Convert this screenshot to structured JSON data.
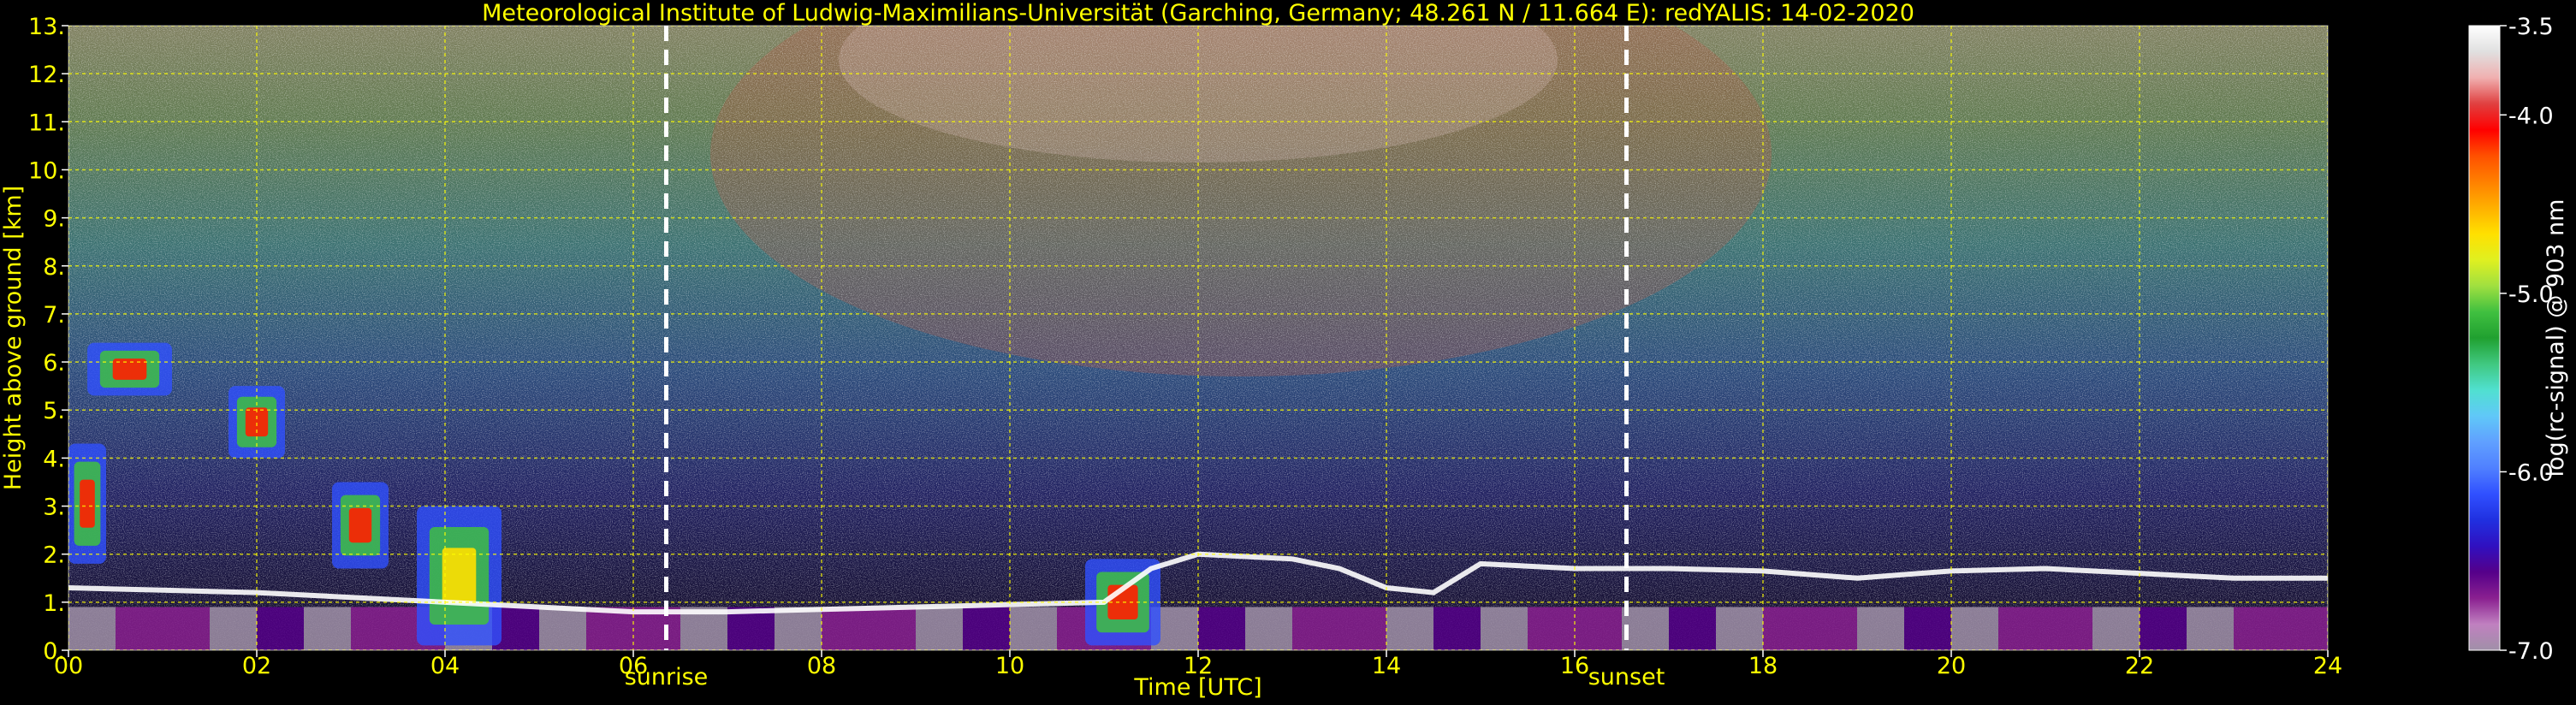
{
  "chart_data": {
    "type": "heatmap",
    "title": "Meteorological Institute of Ludwig-Maximilians-Universität (Garching, Germany; 48.261 N / 11.664 E):    redYALIS: 14-02-2020",
    "xlabel": "Time [UTC]",
    "ylabel": "Height above ground [km]",
    "xlim": [
      0,
      24
    ],
    "ylim": [
      0,
      13
    ],
    "x_ticks": [
      0,
      2,
      4,
      6,
      8,
      10,
      12,
      14,
      16,
      18,
      20,
      22,
      24
    ],
    "x_tick_labels": [
      "00",
      "02",
      "04",
      "06",
      "08",
      "10",
      "12",
      "14",
      "16",
      "18",
      "20",
      "22",
      "24"
    ],
    "y_ticks": [
      0,
      1,
      2,
      3,
      4,
      5,
      6,
      7,
      8,
      9,
      10,
      11,
      12,
      13
    ],
    "y_tick_labels": [
      "0.",
      "1.",
      "2.",
      "3.",
      "4.",
      "5.",
      "6.",
      "7.",
      "8.",
      "9.",
      "10.",
      "11.",
      "12.",
      "13."
    ],
    "grid": true,
    "markers": [
      {
        "label": "sunrise",
        "x": 6.35
      },
      {
        "label": "sunset",
        "x": 16.55
      }
    ],
    "colorbar": {
      "label": "log(rc-signal) @ 903 nm",
      "range": [
        -7.0,
        -3.5
      ],
      "tick_values": [
        -7.0,
        -6.0,
        -5.0,
        -4.0,
        -3.5
      ],
      "tick_labels": [
        "-7.0",
        "-6.0",
        "-5.0",
        "-4.0",
        "-3.5"
      ],
      "colors": [
        "#a090a8",
        "#c080c0",
        "#8a2090",
        "#55008a",
        "#3010c0",
        "#2030e0",
        "#3050ff",
        "#5080ff",
        "#60a0ff",
        "#60c8f8",
        "#50e0d0",
        "#40c880",
        "#20a030",
        "#40c040",
        "#a0e040",
        "#e0f020",
        "#ffe000",
        "#ffb000",
        "#ff8000",
        "#ff5000",
        "#ff0000",
        "#e04040",
        "#f0b0b0",
        "#e0e0e0",
        "#ffffff"
      ]
    },
    "boundary_layer_top_km": [
      [
        0,
        1.3
      ],
      [
        1,
        1.25
      ],
      [
        2,
        1.2
      ],
      [
        3,
        1.1
      ],
      [
        4,
        1.0
      ],
      [
        5,
        0.9
      ],
      [
        6,
        0.8
      ],
      [
        7,
        0.8
      ],
      [
        8,
        0.85
      ],
      [
        9,
        0.9
      ],
      [
        10,
        0.95
      ],
      [
        11,
        1.0
      ],
      [
        11.5,
        1.7
      ],
      [
        12,
        2.0
      ],
      [
        13,
        1.9
      ],
      [
        13.5,
        1.7
      ],
      [
        14,
        1.3
      ],
      [
        14.5,
        1.2
      ],
      [
        15,
        1.8
      ],
      [
        16,
        1.7
      ],
      [
        17,
        1.7
      ],
      [
        18,
        1.65
      ],
      [
        19,
        1.5
      ],
      [
        20,
        1.65
      ],
      [
        21,
        1.7
      ],
      [
        22,
        1.6
      ],
      [
        23,
        1.5
      ],
      [
        24,
        1.5
      ]
    ],
    "cloud_features": [
      {
        "t0": 0.0,
        "t1": 0.4,
        "h0": 1.8,
        "h1": 4.3,
        "peak": "red"
      },
      {
        "t0": 0.2,
        "t1": 1.1,
        "h0": 5.3,
        "h1": 6.4,
        "peak": "red"
      },
      {
        "t0": 1.7,
        "t1": 2.3,
        "h0": 4.0,
        "h1": 5.5,
        "peak": "red"
      },
      {
        "t0": 2.8,
        "t1": 3.4,
        "h0": 1.7,
        "h1": 3.5,
        "peak": "red"
      },
      {
        "t0": 3.7,
        "t1": 4.6,
        "h0": 0.1,
        "h1": 3.0,
        "peak": "yellow"
      },
      {
        "t0": 10.8,
        "t1": 11.6,
        "h0": 0.1,
        "h1": 1.9,
        "peak": "red"
      }
    ]
  }
}
